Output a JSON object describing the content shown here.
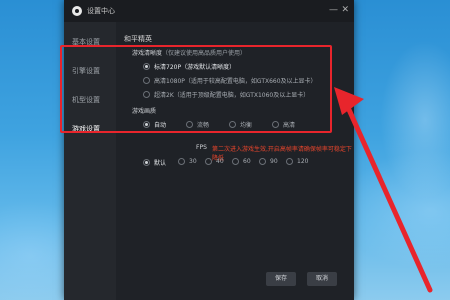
{
  "window": {
    "title": "设置中心",
    "minimize_icon": "minimize-icon",
    "close_icon": "close-icon"
  },
  "sidebar": {
    "items": [
      {
        "label": "基本设置",
        "active": false
      },
      {
        "label": "引擎设置",
        "active": false
      },
      {
        "label": "机型设置",
        "active": false
      },
      {
        "label": "游戏设置",
        "active": true
      }
    ]
  },
  "game": {
    "section_title": "和平精英",
    "resolution": {
      "label": "游戏清晰度",
      "note": "（仅建议使用高品质用户使用）",
      "options": [
        {
          "label": "标清720P（游戏默认清晰度）",
          "checked": true
        },
        {
          "label": "高清1080P（适用于较高配置电脑，如GTX660及以上显卡）",
          "checked": false
        },
        {
          "label": "超清2K（适用于顶级配置电脑，如GTX1060及以上显卡）",
          "checked": false
        }
      ]
    },
    "quality": {
      "label": "游戏画质",
      "options": [
        {
          "label": "自动",
          "checked": true
        },
        {
          "label": "流畅",
          "checked": false
        },
        {
          "label": "均衡",
          "checked": false
        },
        {
          "label": "高清",
          "checked": false
        }
      ]
    },
    "fps": {
      "label": "FPS",
      "warning": "第二次进入游戏生效,开启高帧率请确保帧率可稳定下降低",
      "options": [
        {
          "label": "默认",
          "checked": true
        },
        {
          "label": "30",
          "checked": false
        },
        {
          "label": "40",
          "checked": false
        },
        {
          "label": "60",
          "checked": false
        },
        {
          "label": "90",
          "checked": false
        },
        {
          "label": "120",
          "checked": false
        }
      ]
    }
  },
  "footer": {
    "save_label": "保存",
    "cancel_label": "取消"
  },
  "colors": {
    "highlight_box": "#e8252c",
    "arrow": "#e8252c",
    "warning": "#e8452c"
  }
}
